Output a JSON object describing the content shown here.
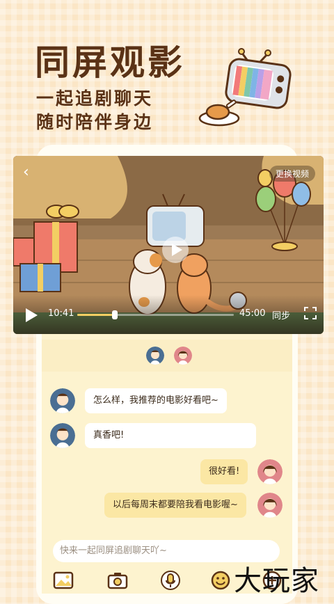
{
  "hero": {
    "title": "同屏观影",
    "subtitle_1": "一起追剧聊天",
    "subtitle_2": "随时陪伴身边"
  },
  "video": {
    "change_label": "更换视频",
    "current_time": "10:41",
    "duration": "45:00",
    "progress": 0.2378,
    "sync_label": "同步"
  },
  "chat": {
    "messages": [
      {
        "side": "left",
        "text": "怎么样，我推荐的电影好看吧~"
      },
      {
        "side": "left",
        "text": "真香吧!"
      },
      {
        "side": "right",
        "text": "很好看!"
      },
      {
        "side": "right",
        "text": "以后每周末都要陪我看电影喔~"
      }
    ],
    "input_placeholder": "快来一起同屏追剧聊天吖~",
    "toolbar_icons": [
      "image-icon",
      "camera-icon",
      "microphone-icon",
      "emoji-icon",
      "add-icon"
    ]
  },
  "watermark": "大玩家",
  "colors": {
    "brand_brown": "#5a3216",
    "accent_yellow": "#f3ce63",
    "chat_bg": "#fdf3cf",
    "bubble_self": "#fbe7a4",
    "avatar_male": "#4a6e93",
    "avatar_female": "#e0868a"
  }
}
